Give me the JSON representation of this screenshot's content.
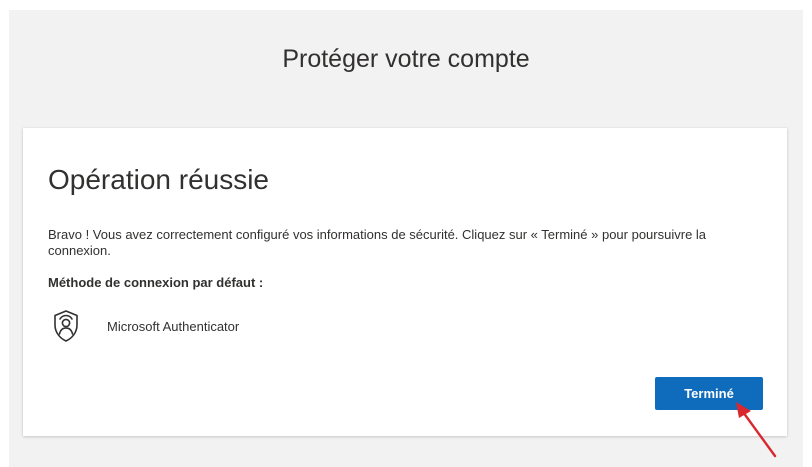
{
  "header": {
    "title": "Protéger votre compte"
  },
  "card": {
    "title": "Opération réussie",
    "message": "Bravo ! Vous avez correctement configuré vos informations de sécurité. Cliquez sur « Terminé » pour poursuivre la connexion.",
    "default_method_label": "Méthode de connexion par défaut :",
    "default_method": {
      "icon": "authenticator-icon",
      "name": "Microsoft Authenticator"
    },
    "done_button_label": "Terminé"
  },
  "annotation": {
    "icon": "red-arrow-icon",
    "color": "#d9272e"
  },
  "colors": {
    "accent": "#0f6cbd",
    "background": "#f2f2f2"
  }
}
